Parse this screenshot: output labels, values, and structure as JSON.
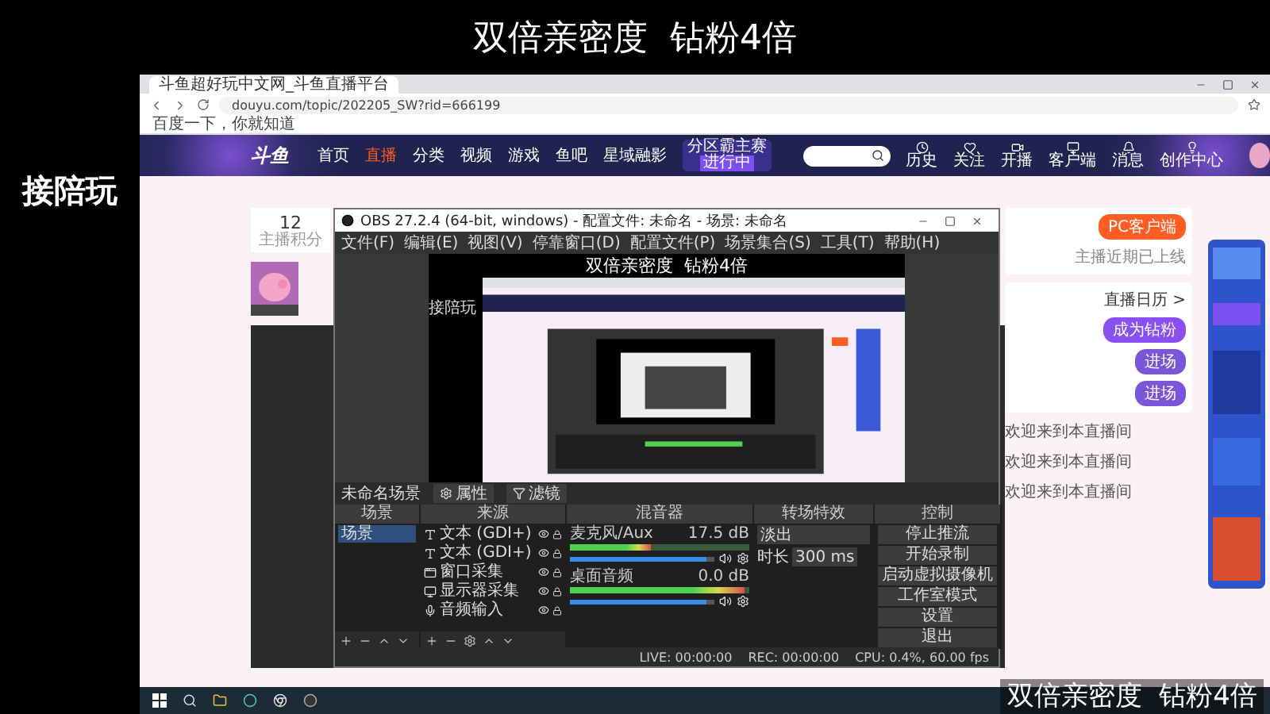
{
  "captions": {
    "top": "双倍亲密度  钻粉4倍",
    "side": "接陪玩",
    "bottom": "双倍亲密度  钻粉4倍"
  },
  "browser": {
    "tabs": [
      {
        "title": "斗鱼超好玩中文网_斗鱼直播平台",
        "selected": true
      }
    ],
    "address": "douyu.com/topic/202205_SW?rid=666199",
    "bookmarks": [
      "百度一下，你就知道"
    ],
    "site_nav": {
      "logo": "斗鱼",
      "items": [
        {
          "label": "首页",
          "selected": false
        },
        {
          "label": "直播",
          "selected": true
        },
        {
          "label": "分类",
          "selected": false
        },
        {
          "label": "视频",
          "selected": false
        },
        {
          "label": "游戏",
          "selected": false
        },
        {
          "label": "鱼吧",
          "selected": false
        },
        {
          "label": "星域融影",
          "selected": false
        }
      ],
      "promo": "分区霸主赛",
      "promo_badge": "进行中",
      "actions": [
        {
          "kind": "history",
          "label": "历史"
        },
        {
          "kind": "follow",
          "label": "关注"
        },
        {
          "kind": "live",
          "label": "开播"
        },
        {
          "kind": "client",
          "label": "客户端"
        },
        {
          "kind": "message",
          "label": "消息"
        },
        {
          "kind": "create",
          "label": "创作中心"
        }
      ]
    },
    "anchor_card": {
      "score": "12",
      "score_label": "主播积分"
    },
    "side_panel": {
      "client_button": "PC客户端",
      "client_note": "主播近期已上线",
      "calendar_link": "直播日历 >",
      "fan_button": "成为钻粉",
      "enter_buttons": [
        "进场",
        "进场"
      ],
      "chat": [
        "欢迎来到本直播间",
        "欢迎来到本直播间",
        "欢迎来到本直播间"
      ]
    }
  },
  "obs": {
    "title": "OBS 27.2.4 (64-bit, windows) - 配置文件: 未命名 - 场景: 未命名",
    "menu": [
      "文件(F)",
      "编辑(E)",
      "视图(V)",
      "停靠窗口(D)",
      "配置文件(P)",
      "场景集合(S)",
      "工具(T)",
      "帮助(H)"
    ],
    "preview": {
      "caption": "双倍亲密度  钻粉4倍",
      "side_caption": "接陪玩"
    },
    "scene_name": "未命名场景",
    "scene_buttons": [
      {
        "kind": "properties",
        "label": "属性"
      },
      {
        "kind": "filters",
        "label": "滤镜"
      }
    ],
    "docks": [
      "场景",
      "来源",
      "混音器",
      "转场特效",
      "控制"
    ],
    "scenes": [
      {
        "name": "场景",
        "selected": true
      }
    ],
    "sources": [
      {
        "kind": "text",
        "name": "文本 (GDI+)"
      },
      {
        "kind": "text",
        "name": "文本 (GDI+)"
      },
      {
        "kind": "window",
        "name": "窗口采集"
      },
      {
        "kind": "monitor",
        "name": "显示器采集"
      },
      {
        "kind": "audio",
        "name": "音频输入"
      }
    ],
    "mixer": [
      {
        "name": "麦克风/Aux",
        "reading": "17.5 dB",
        "meter": {
          "level": 0.45
        },
        "volume": {
          "level": 0.95
        }
      },
      {
        "name": "桌面音频",
        "reading": "0.0 dB",
        "meter": {
          "level": 0.97
        },
        "volume": {
          "level": 0.95
        }
      }
    ],
    "transition": {
      "type": "淡出",
      "duration_label": "时长",
      "duration": "300 ms"
    },
    "controls": [
      "停止推流",
      "开始录制",
      "启动虚拟摄像机",
      "工作室模式",
      "设置",
      "退出"
    ],
    "status": [
      "LIVE: 00:00:00",
      "REC: 00:00:00",
      "CPU: 0.4%, 60.00 fps"
    ]
  }
}
